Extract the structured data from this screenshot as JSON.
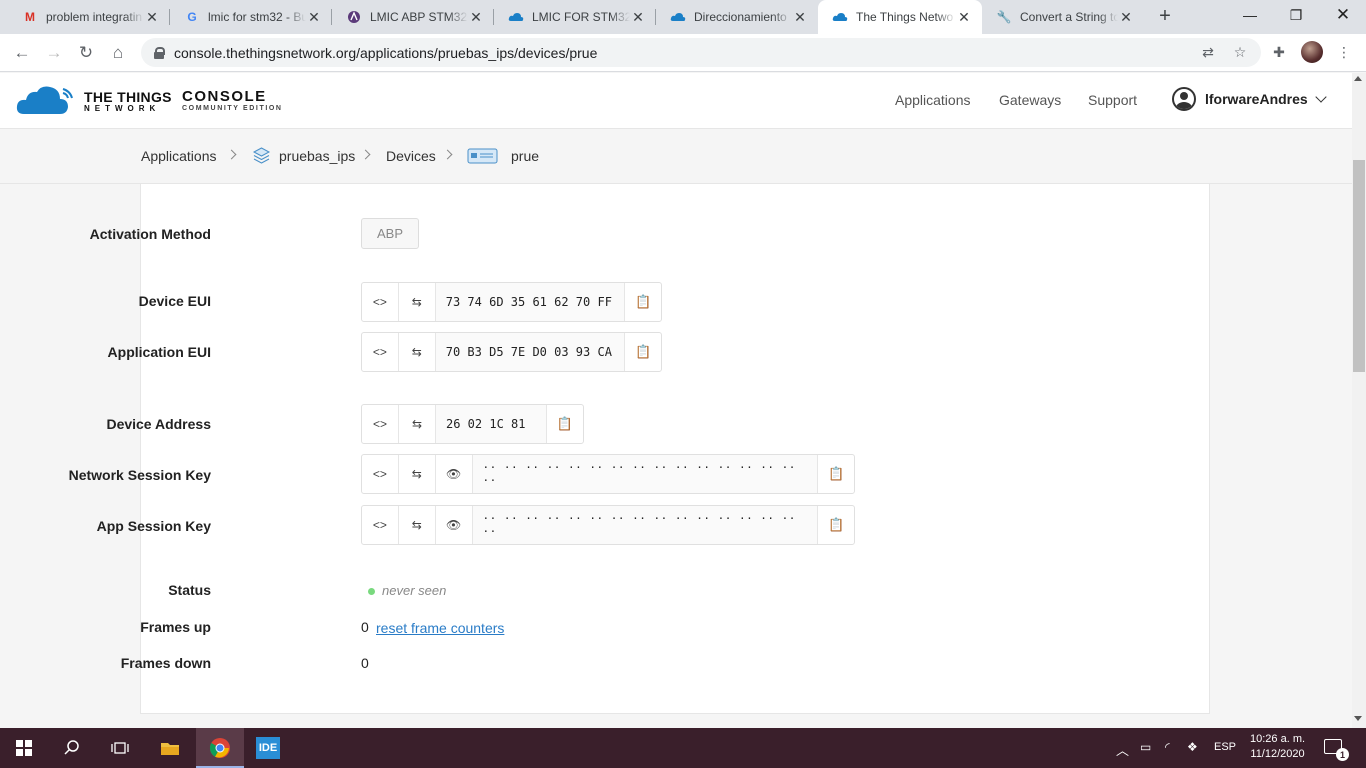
{
  "browser": {
    "tabs": [
      {
        "title": "problem integratin",
        "icon": "gmail-icon",
        "active": false
      },
      {
        "title": "lmic for stm32 - Bu",
        "icon": "google-icon",
        "active": false
      },
      {
        "title": "LMIC ABP STM32C",
        "icon": "forum-icon",
        "active": false
      },
      {
        "title": "LMIC FOR STM32C",
        "icon": "ttn-cloud-icon",
        "active": false
      },
      {
        "title": "Direccionamiento",
        "icon": "ttn-cloud-icon",
        "active": false
      },
      {
        "title": "The Things Netwo",
        "icon": "ttn-cloud-icon",
        "active": true
      },
      {
        "title": "Convert a String to",
        "icon": "wrench-icon",
        "active": false
      }
    ],
    "url": "console.thethingsnetwork.org/applications/pruebas_ips/devices/prue"
  },
  "header": {
    "logo_line1": "THE THINGS",
    "logo_line2": "NETWORK",
    "logo_console": "CONSOLE",
    "logo_edition": "COMMUNITY EDITION",
    "nav": [
      "Applications",
      "Gateways",
      "Support"
    ],
    "username": "lforwareAndres"
  },
  "breadcrumb": {
    "applications": "Applications",
    "app": "pruebas_ips",
    "devices": "Devices",
    "device": "prue"
  },
  "device": {
    "activation_label": "Activation Method",
    "activation_value": "ABP",
    "dev_eui_label": "Device EUI",
    "dev_eui": "73 74 6D 35 61 62 70 FF",
    "app_eui_label": "Application EUI",
    "app_eui": "70 B3 D5 7E D0 03 93 CA",
    "dev_addr_label": "Device Address",
    "dev_addr": "26 02 1C 81",
    "nwk_skey_label": "Network Session Key",
    "nwk_skey": "·· ·· ·· ·· ·· ·· ·· ·· ·· ·· ·· ·· ·· ·· ·· ··",
    "app_skey_label": "App Session Key",
    "app_skey": "·· ·· ·· ·· ·· ·· ·· ·· ·· ·· ·· ·· ·· ·· ·· ··",
    "status_label": "Status",
    "status_value": "never seen",
    "frames_up_label": "Frames up",
    "frames_up": "0",
    "reset_link": "reset frame counters",
    "frames_down_label": "Frames down",
    "frames_down": "0"
  },
  "taskbar": {
    "lang": "ESP",
    "time": "10:26 a. m.",
    "date": "11/12/2020",
    "notifications": "1",
    "ide_label": "IDE"
  }
}
